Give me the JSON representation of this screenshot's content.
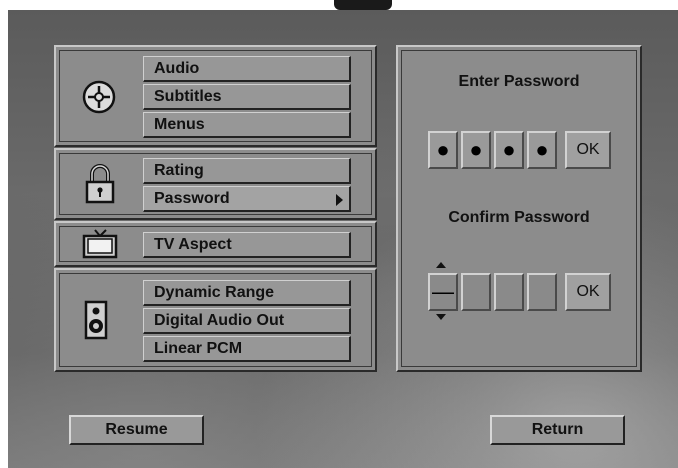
{
  "menu": {
    "audio_group": [
      "Audio",
      "Subtitles",
      "Menus"
    ],
    "rating_group": [
      "Rating",
      "Password"
    ],
    "tv_group": [
      "TV Aspect"
    ],
    "sound_group": [
      "Dynamic Range",
      "Digital Audio Out",
      "Linear PCM"
    ]
  },
  "password_panel": {
    "enter_title": "Enter Password",
    "enter_digits": [
      "●",
      "●",
      "●",
      "●"
    ],
    "enter_ok": "OK",
    "confirm_title": "Confirm Password",
    "confirm_digits": [
      "—",
      "",
      "",
      ""
    ],
    "confirm_ok": "OK"
  },
  "buttons": {
    "resume": "Resume",
    "return": "Return"
  },
  "icons": {
    "audio": "disc-icon",
    "rating": "padlock-icon",
    "tv": "tv-icon",
    "sound": "speaker-icon"
  }
}
